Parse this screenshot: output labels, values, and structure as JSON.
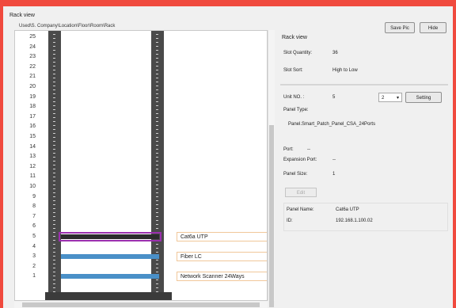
{
  "window": {
    "title": "Rack view",
    "path": "Used\\S. Company\\Location\\Floor\\Room\\Rack"
  },
  "toolbar": {
    "save_label": "Save Pic",
    "hide_label": "Hide"
  },
  "rack": {
    "units": [
      "25",
      "24",
      "23",
      "22",
      "21",
      "20",
      "19",
      "18",
      "17",
      "16",
      "15",
      "14",
      "13",
      "12",
      "11",
      "10",
      "9",
      "8",
      "7",
      "6",
      "5",
      "4",
      "3",
      "2",
      "1"
    ],
    "panels": [
      {
        "unit": "5",
        "label": "Cat6a UTP",
        "selected": true,
        "color": "#4a90c8"
      },
      {
        "unit": "3",
        "label": "Fiber LC",
        "selected": false,
        "color": "#4a90c8"
      },
      {
        "unit": "1",
        "label": "Network Scanner 24Ways",
        "selected": false,
        "color": "#4a90c8"
      }
    ],
    "highlight_color": "#9b2fae",
    "label_border_color": "#f1c79a"
  },
  "properties": {
    "section_title": "Rack view",
    "slot_quantity_label": "Slot Quantity:",
    "slot_quantity_value": "36",
    "slot_sort_label": "Slot Sort:",
    "slot_sort_value": "High to Low",
    "unit_no_label": "Unit NO. :",
    "unit_no_value": "5",
    "select_value": "2",
    "setting_label": "Setting",
    "panel_type_label": "Panel Type:",
    "panel_type_value": "Panel.Smart_Patch_Panel_CSA_24Ports",
    "port_label": "Port:",
    "port_value": "--",
    "expansion_port_label": "Expansion Port:",
    "expansion_port_value": "--",
    "panel_size_label": "Panel Size:",
    "panel_size_value": "1",
    "edit_label": "Edit",
    "panel_name_label": "Panel Name:",
    "panel_name_value": "Cat6a UTP",
    "id_label": "ID:",
    "id_value": "192.168.1.100.02"
  }
}
